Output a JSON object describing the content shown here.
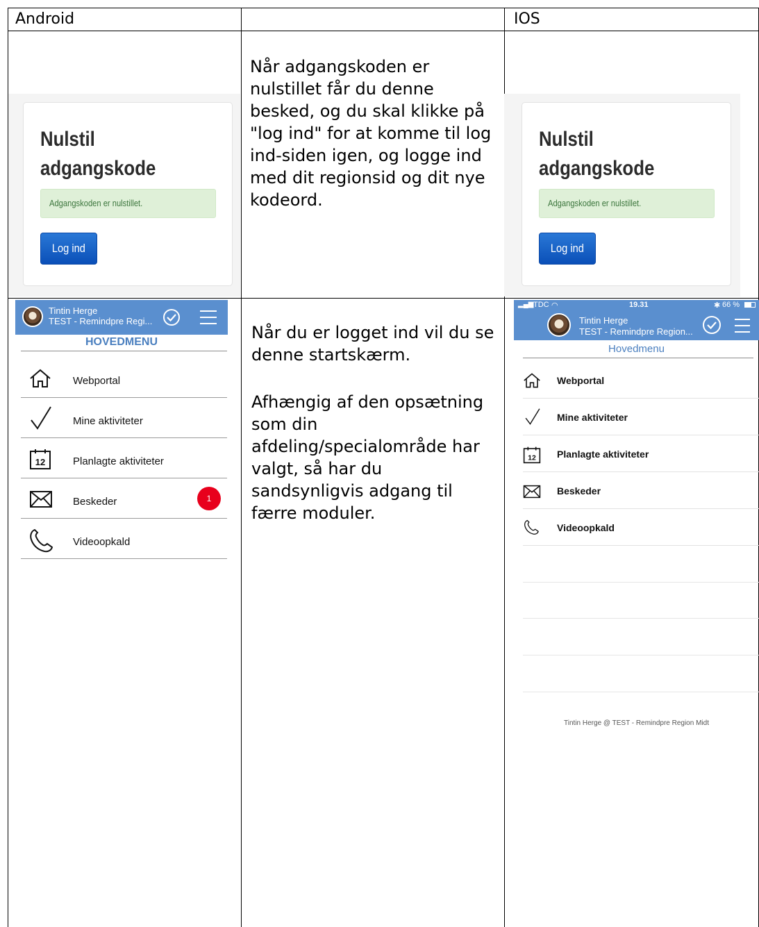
{
  "table": {
    "header_left": "Android",
    "header_middle": "",
    "header_right": "IOS"
  },
  "row1": {
    "description": "Når adgangskoden er nulstillet får du denne besked, og du skal klikke på \"log ind\" for at komme til log ind-siden igen, og logge ind med dit regionsid og dit nye kodeord.",
    "reset_title_line1": "Nulstil",
    "reset_title_line2": "adgangskode",
    "alert_text": "Adgangskoden er nulstillet.",
    "login_button": "Log ind"
  },
  "row2": {
    "description_p1": "Når du er logget ind vil du se denne startskærm.",
    "description_p2": "Afhængig af den opsætning som din afdeling/specialområde har valgt, så har du sandsynligvis adgang til færre moduler."
  },
  "android": {
    "user_name": "Tintin Herge",
    "user_org": "TEST - Remindpre Regi...",
    "menu_title": "HOVEDMENU",
    "items": [
      {
        "label": "Webportal",
        "icon": "home-icon"
      },
      {
        "label": "Mine aktiviteter",
        "icon": "checkmark-icon"
      },
      {
        "label": "Planlagte aktiviteter",
        "icon": "calendar-icon",
        "calendar_day": "12"
      },
      {
        "label": "Beskeder",
        "icon": "envelope-icon",
        "badge": "1"
      },
      {
        "label": "Videoopkald",
        "icon": "phone-icon"
      }
    ],
    "colors": {
      "header": "#5a8fcf",
      "badge": "#e8001c",
      "menu_title": "#4a7fbf"
    }
  },
  "ios": {
    "status_carrier": "TDC",
    "status_time": "19.31",
    "status_battery": "66 %",
    "user_name": "Tintin Herge",
    "user_org": "TEST - Remindpre Region...",
    "menu_title": "Hovedmenu",
    "items": [
      {
        "label": "Webportal",
        "icon": "home-icon"
      },
      {
        "label": "Mine aktiviteter",
        "icon": "checkmark-icon"
      },
      {
        "label": "Planlagte aktiviteter",
        "icon": "calendar-icon",
        "calendar_day": "12"
      },
      {
        "label": "Beskeder",
        "icon": "envelope-icon"
      },
      {
        "label": "Videoopkald",
        "icon": "phone-icon"
      }
    ],
    "footer": "Tintin Herge @ TEST - Remindpre Region Midt"
  }
}
